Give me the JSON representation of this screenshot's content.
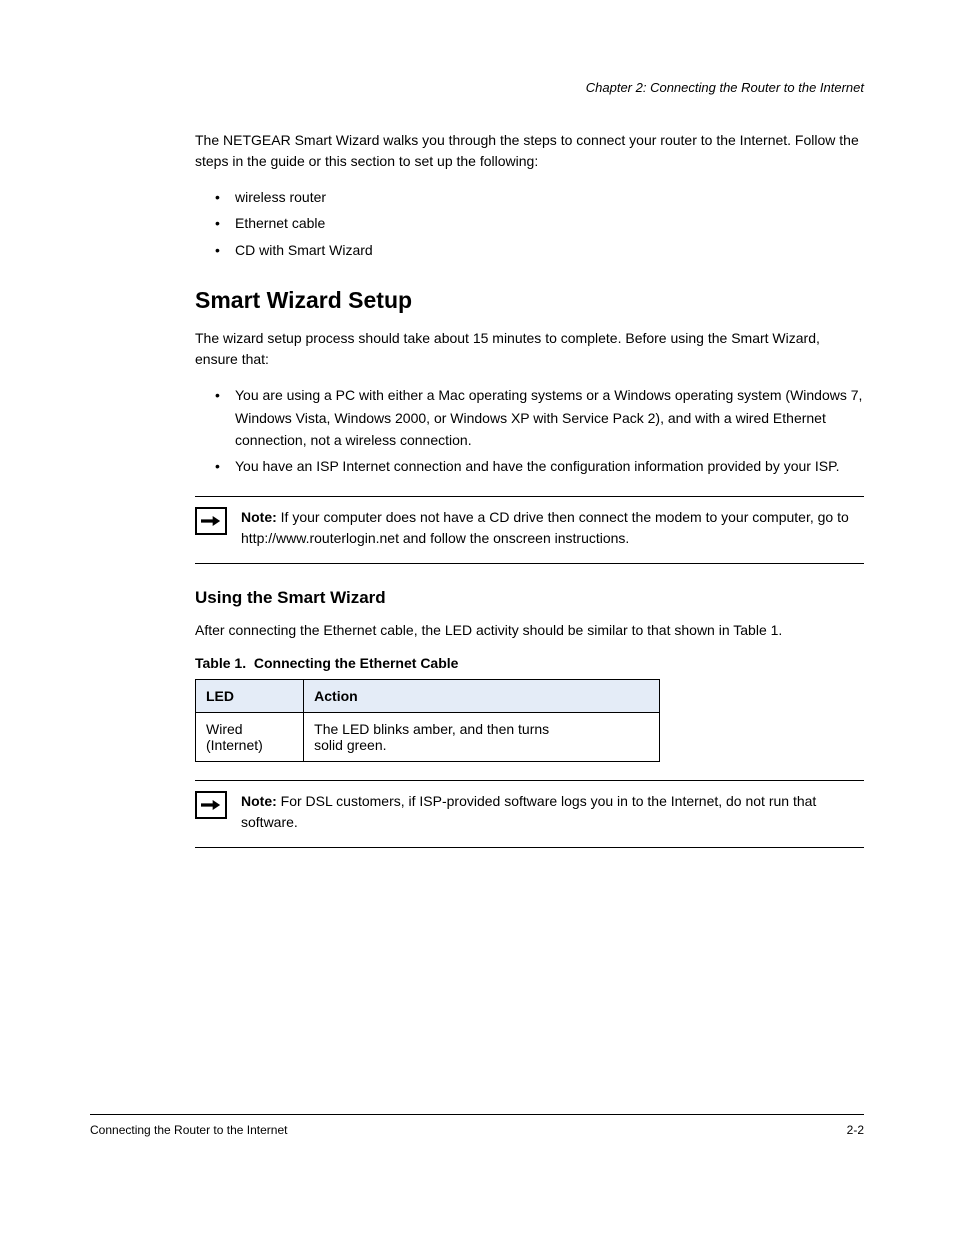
{
  "header": {
    "right": "Chapter 2: Connecting the Router to the Internet"
  },
  "intro": "The NETGEAR Smart Wizard walks you through the steps to connect your router to the Internet. Follow the steps in the guide or this section to set up the following:",
  "bullets": [
    "wireless router",
    "Ethernet cable",
    "CD with Smart Wizard"
  ],
  "s1": {
    "head": "Smart Wizard Setup",
    "para": "The wizard setup process should take about 15 minutes to complete. Before using the Smart Wizard, ensure that:",
    "items": [
      "You are using a PC with either a Mac operating systems or a Windows operating system (Windows 7, Windows Vista, Windows 2000, or Windows XP with Service Pack 2), and with a wired Ethernet connection, not a wireless connection.",
      "You have an ISP Internet connection and have the configuration information provided by your ISP."
    ],
    "note_label": "Note:",
    "note_text": " If your computer does not have a CD drive then connect the modem to your computer, go to http://www.routerlogin.net and follow the onscreen instructions."
  },
  "s2": {
    "head": "Using the Smart Wizard",
    "para": "After connecting the Ethernet cable, the LED activity should be similar to that shown in Table 1.",
    "table_ref": "Table 1.",
    "table_title": "Connecting the Ethernet Cable",
    "th1": "LED",
    "th2": "Action",
    "td1_a": "Wired",
    "td1_b": "(Internet)",
    "td2_a": "The LED blinks amber, and then turns",
    "td2_b": "solid green.",
    "note_label": "Note:",
    "note_text": " For DSL customers, if ISP-provided software logs you in to the Internet, do not run that software."
  },
  "footer": {
    "left": "Connecting the Router to the Internet",
    "right": "2-2"
  }
}
